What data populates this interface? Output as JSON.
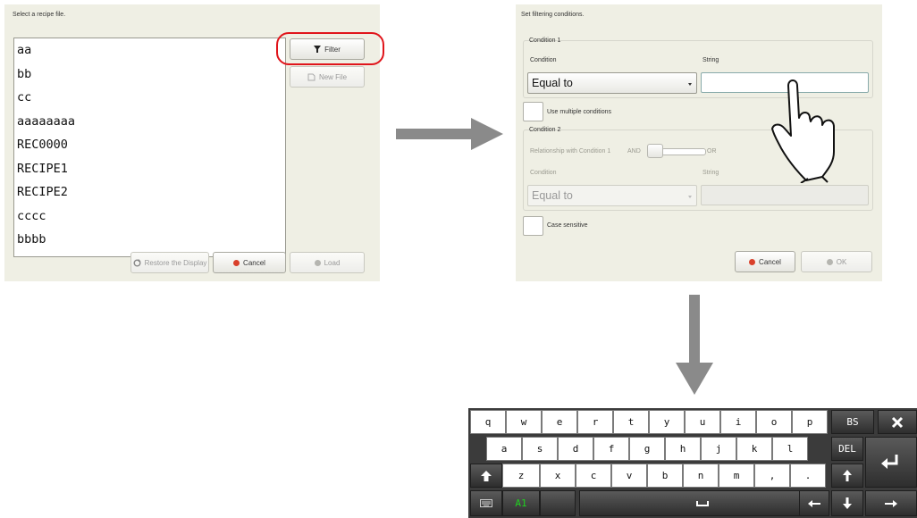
{
  "left_panel": {
    "title": "Select a recipe file.",
    "files": [
      "aa",
      "bb",
      "cc",
      "aaaaaaaa",
      "REC0000",
      "RECIPE1",
      "RECIPE2",
      "cccc",
      "bbbb"
    ],
    "filter_label": "Filter",
    "new_file_label": "New File",
    "restore_label": "Restore the Display",
    "cancel_label": "Cancel",
    "load_label": "Load"
  },
  "right_panel": {
    "title": "Set filtering conditions.",
    "condition1": {
      "group_label": "Condition 1",
      "condition_label": "Condition",
      "string_label": "String",
      "selected": "Equal to",
      "string_value": ""
    },
    "use_multiple_label": "Use multiple conditions",
    "condition2": {
      "group_label": "Condition 2",
      "relationship_label": "Relationship with Condition 1",
      "and_label": "AND",
      "or_label": "OR",
      "condition_label": "Condition",
      "string_label": "String",
      "selected": "Equal to",
      "string_value": ""
    },
    "case_sensitive_label": "Case sensitive",
    "cancel_label": "Cancel",
    "ok_label": "OK"
  },
  "keyboard": {
    "row1": [
      "q",
      "w",
      "e",
      "r",
      "t",
      "y",
      "u",
      "i",
      "o",
      "p"
    ],
    "row2": [
      "a",
      "s",
      "d",
      "f",
      "g",
      "h",
      "j",
      "k",
      "l"
    ],
    "row3": [
      "z",
      "x",
      "c",
      "v",
      "b",
      "n",
      "m",
      ",",
      "."
    ],
    "bs_label": "BS",
    "del_label": "DEL",
    "mode_label": "A1"
  },
  "colors": {
    "panel_bg": "#efefe4",
    "highlight": "#e0151b",
    "arrow": "#8a8a8a",
    "keyboard_bg": "#3b3b3b",
    "mode_green": "#1fd11f"
  }
}
